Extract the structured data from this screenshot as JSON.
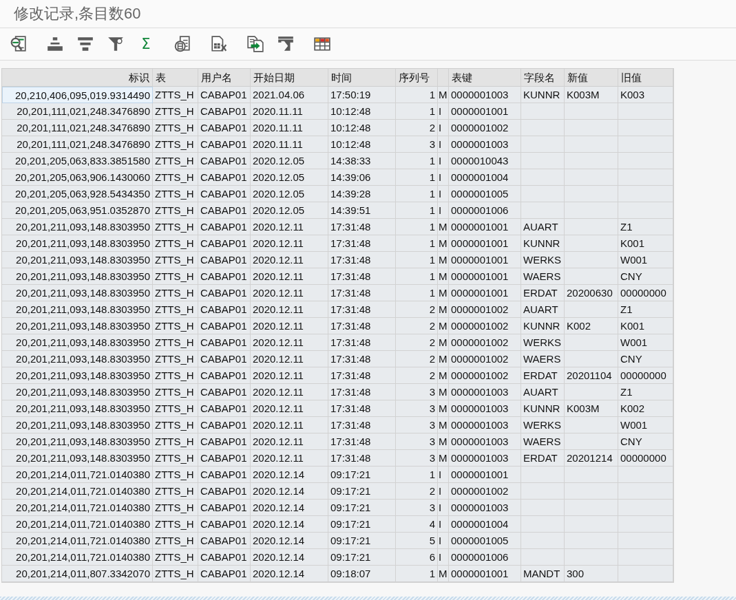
{
  "window": {
    "title": "修改记录,条目数60"
  },
  "toolbar": {
    "sum_label": "Σ"
  },
  "table": {
    "columns": [
      "标识",
      "表",
      "用户名",
      "开始日期",
      "时间",
      "序列号",
      null,
      "表键",
      "字段名",
      "新值",
      "旧值"
    ],
    "rows": [
      {
        "selected": true,
        "cells": [
          "20,210,406,095,019.9314490",
          "ZTTS_H",
          "CABAP01",
          "2021.04.06",
          "17:50:19",
          "1",
          "M",
          "0000001003",
          "KUNNR",
          "K003M",
          "K003"
        ]
      },
      {
        "selected": false,
        "cells": [
          "20,201,111,021,248.3476890",
          "ZTTS_H",
          "CABAP01",
          "2020.11.11",
          "10:12:48",
          "1",
          "I",
          "0000001001",
          null,
          null,
          null
        ]
      },
      {
        "selected": false,
        "cells": [
          "20,201,111,021,248.3476890",
          "ZTTS_H",
          "CABAP01",
          "2020.11.11",
          "10:12:48",
          "2",
          "I",
          "0000001002",
          null,
          null,
          null
        ]
      },
      {
        "selected": false,
        "cells": [
          "20,201,111,021,248.3476890",
          "ZTTS_H",
          "CABAP01",
          "2020.11.11",
          "10:12:48",
          "3",
          "I",
          "0000001003",
          null,
          null,
          null
        ]
      },
      {
        "selected": false,
        "cells": [
          "20,201,205,063,833.3851580",
          "ZTTS_H",
          "CABAP01",
          "2020.12.05",
          "14:38:33",
          "1",
          "I",
          "0000010043",
          null,
          null,
          null
        ]
      },
      {
        "selected": false,
        "cells": [
          "20,201,205,063,906.1430060",
          "ZTTS_H",
          "CABAP01",
          "2020.12.05",
          "14:39:06",
          "1",
          "I",
          "0000001004",
          null,
          null,
          null
        ]
      },
      {
        "selected": false,
        "cells": [
          "20,201,205,063,928.5434350",
          "ZTTS_H",
          "CABAP01",
          "2020.12.05",
          "14:39:28",
          "1",
          "I",
          "0000001005",
          null,
          null,
          null
        ]
      },
      {
        "selected": false,
        "cells": [
          "20,201,205,063,951.0352870",
          "ZTTS_H",
          "CABAP01",
          "2020.12.05",
          "14:39:51",
          "1",
          "I",
          "0000001006",
          null,
          null,
          null
        ]
      },
      {
        "selected": false,
        "cells": [
          "20,201,211,093,148.8303950",
          "ZTTS_H",
          "CABAP01",
          "2020.12.11",
          "17:31:48",
          "1",
          "M",
          "0000001001",
          "AUART",
          null,
          "Z1"
        ]
      },
      {
        "selected": false,
        "cells": [
          "20,201,211,093,148.8303950",
          "ZTTS_H",
          "CABAP01",
          "2020.12.11",
          "17:31:48",
          "1",
          "M",
          "0000001001",
          "KUNNR",
          null,
          "K001"
        ]
      },
      {
        "selected": false,
        "cells": [
          "20,201,211,093,148.8303950",
          "ZTTS_H",
          "CABAP01",
          "2020.12.11",
          "17:31:48",
          "1",
          "M",
          "0000001001",
          "WERKS",
          null,
          "W001"
        ]
      },
      {
        "selected": false,
        "cells": [
          "20,201,211,093,148.8303950",
          "ZTTS_H",
          "CABAP01",
          "2020.12.11",
          "17:31:48",
          "1",
          "M",
          "0000001001",
          "WAERS",
          null,
          "CNY"
        ]
      },
      {
        "selected": false,
        "cells": [
          "20,201,211,093,148.8303950",
          "ZTTS_H",
          "CABAP01",
          "2020.12.11",
          "17:31:48",
          "1",
          "M",
          "0000001001",
          "ERDAT",
          "20200630",
          "00000000"
        ]
      },
      {
        "selected": false,
        "cells": [
          "20,201,211,093,148.8303950",
          "ZTTS_H",
          "CABAP01",
          "2020.12.11",
          "17:31:48",
          "2",
          "M",
          "0000001002",
          "AUART",
          null,
          "Z1"
        ]
      },
      {
        "selected": false,
        "cells": [
          "20,201,211,093,148.8303950",
          "ZTTS_H",
          "CABAP01",
          "2020.12.11",
          "17:31:48",
          "2",
          "M",
          "0000001002",
          "KUNNR",
          "K002",
          "K001"
        ]
      },
      {
        "selected": false,
        "cells": [
          "20,201,211,093,148.8303950",
          "ZTTS_H",
          "CABAP01",
          "2020.12.11",
          "17:31:48",
          "2",
          "M",
          "0000001002",
          "WERKS",
          null,
          "W001"
        ]
      },
      {
        "selected": false,
        "cells": [
          "20,201,211,093,148.8303950",
          "ZTTS_H",
          "CABAP01",
          "2020.12.11",
          "17:31:48",
          "2",
          "M",
          "0000001002",
          "WAERS",
          null,
          "CNY"
        ]
      },
      {
        "selected": false,
        "cells": [
          "20,201,211,093,148.8303950",
          "ZTTS_H",
          "CABAP01",
          "2020.12.11",
          "17:31:48",
          "2",
          "M",
          "0000001002",
          "ERDAT",
          "20201104",
          "00000000"
        ]
      },
      {
        "selected": false,
        "cells": [
          "20,201,211,093,148.8303950",
          "ZTTS_H",
          "CABAP01",
          "2020.12.11",
          "17:31:48",
          "3",
          "M",
          "0000001003",
          "AUART",
          null,
          "Z1"
        ]
      },
      {
        "selected": false,
        "cells": [
          "20,201,211,093,148.8303950",
          "ZTTS_H",
          "CABAP01",
          "2020.12.11",
          "17:31:48",
          "3",
          "M",
          "0000001003",
          "KUNNR",
          "K003M",
          "K002"
        ]
      },
      {
        "selected": false,
        "cells": [
          "20,201,211,093,148.8303950",
          "ZTTS_H",
          "CABAP01",
          "2020.12.11",
          "17:31:48",
          "3",
          "M",
          "0000001003",
          "WERKS",
          null,
          "W001"
        ]
      },
      {
        "selected": false,
        "cells": [
          "20,201,211,093,148.8303950",
          "ZTTS_H",
          "CABAP01",
          "2020.12.11",
          "17:31:48",
          "3",
          "M",
          "0000001003",
          "WAERS",
          null,
          "CNY"
        ]
      },
      {
        "selected": false,
        "cells": [
          "20,201,211,093,148.8303950",
          "ZTTS_H",
          "CABAP01",
          "2020.12.11",
          "17:31:48",
          "3",
          "M",
          "0000001003",
          "ERDAT",
          "20201214",
          "00000000"
        ]
      },
      {
        "selected": false,
        "cells": [
          "20,201,214,011,721.0140380",
          "ZTTS_H",
          "CABAP01",
          "2020.12.14",
          "09:17:21",
          "1",
          "I",
          "0000001001",
          null,
          null,
          null
        ]
      },
      {
        "selected": false,
        "cells": [
          "20,201,214,011,721.0140380",
          "ZTTS_H",
          "CABAP01",
          "2020.12.14",
          "09:17:21",
          "2",
          "I",
          "0000001002",
          null,
          null,
          null
        ]
      },
      {
        "selected": false,
        "cells": [
          "20,201,214,011,721.0140380",
          "ZTTS_H",
          "CABAP01",
          "2020.12.14",
          "09:17:21",
          "3",
          "I",
          "0000001003",
          null,
          null,
          null
        ]
      },
      {
        "selected": false,
        "cells": [
          "20,201,214,011,721.0140380",
          "ZTTS_H",
          "CABAP01",
          "2020.12.14",
          "09:17:21",
          "4",
          "I",
          "0000001004",
          null,
          null,
          null
        ]
      },
      {
        "selected": false,
        "cells": [
          "20,201,214,011,721.0140380",
          "ZTTS_H",
          "CABAP01",
          "2020.12.14",
          "09:17:21",
          "5",
          "I",
          "0000001005",
          null,
          null,
          null
        ]
      },
      {
        "selected": false,
        "cells": [
          "20,201,214,011,721.0140380",
          "ZTTS_H",
          "CABAP01",
          "2020.12.14",
          "09:17:21",
          "6",
          "I",
          "0000001006",
          null,
          null,
          null
        ]
      },
      {
        "selected": false,
        "cells": [
          "20,201,214,011,807.3342070",
          "ZTTS_H",
          "CABAP01",
          "2020.12.14",
          "09:18:07",
          "1",
          "M",
          "0000001001",
          "MANDT",
          "300",
          null
        ]
      }
    ]
  }
}
